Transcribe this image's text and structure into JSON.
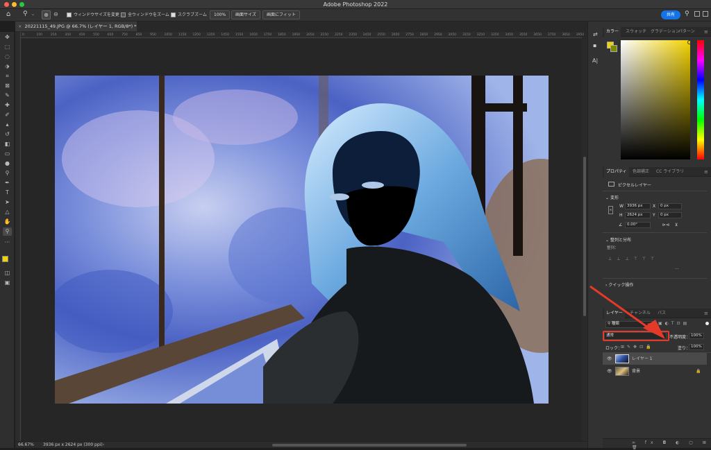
{
  "window": {
    "title": "Adobe Photoshop 2022"
  },
  "options_bar": {
    "resize_windows_label": "ウィンドウサイズを変更",
    "zoom_all_label": "全ウィンドウをズーム",
    "scrubby_zoom_label": "スクラブズーム",
    "zoom_value": "100%",
    "fit_screen_label": "画面サイズ",
    "fill_screen_label": "画面にフィット",
    "share_label": "共有"
  },
  "document": {
    "tab_title": "20221115_49.JPG @ 66.7% (レイヤー 1, RGB/8*) *",
    "ruler_ticks": [
      "0",
      "100",
      "150",
      "200",
      "250",
      "300",
      "350",
      "400",
      "450",
      "500",
      "550",
      "600",
      "650",
      "700",
      "750",
      "800",
      "850",
      "900",
      "950",
      "1000",
      "1050",
      "1100",
      "1150",
      "1200",
      "1250",
      "1300",
      "1350",
      "1400",
      "1450",
      "1500",
      "1550",
      "1600",
      "1650",
      "1700",
      "1750",
      "1800",
      "1850",
      "1900",
      "1950",
      "2000",
      "2050",
      "2100",
      "2150",
      "2200",
      "2250",
      "2300",
      "2350",
      "2400",
      "2450",
      "2500",
      "2550",
      "2600",
      "2650",
      "2700",
      "2750",
      "2800",
      "2850",
      "2900",
      "2950",
      "3000",
      "3050",
      "3100",
      "3150",
      "3200",
      "3250",
      "3300",
      "3350",
      "3400",
      "3450",
      "3500",
      "3550",
      "3600",
      "3650",
      "3700",
      "3750",
      "3800",
      "3850",
      "3900",
      "3950"
    ]
  },
  "status": {
    "zoom": "66.67%",
    "doc_info": "3936 px x 2624 px (300 ppi)"
  },
  "color_panel": {
    "tabs": [
      "カラー",
      "スウォッチ",
      "グラデーション",
      "パターン"
    ],
    "fg_color": "#f2d200",
    "bg_color": "#7a8a00"
  },
  "properties_panel": {
    "tabs": [
      "プロパティ",
      "色調補正",
      "CC ライブラリ"
    ],
    "layer_type": "ピクセルレイヤー",
    "transform_heading": "変形",
    "w_label": "W",
    "w_value": "3936 px",
    "h_label": "H",
    "h_value": "2624 px",
    "x_label": "X",
    "x_value": "0 px",
    "y_label": "Y",
    "y_value": "0 px",
    "angle_value": "0.00°",
    "align_heading": "整列と分布",
    "align_sub": "整列：",
    "quick_actions_heading": "クイック操作"
  },
  "layers_panel": {
    "tabs": [
      "レイヤー",
      "チャンネル",
      "パス"
    ],
    "filter_label": "種類",
    "blend_mode": "通常",
    "opacity_label": "不透明度：",
    "opacity_value": "100%",
    "lock_label": "ロック：",
    "fill_label": "塗り：",
    "fill_value": "100%",
    "layers": [
      {
        "name": "レイヤー 1",
        "selected": true
      },
      {
        "name": "背景",
        "selected": false
      }
    ]
  },
  "annotation": {
    "highlight_color": "#e53a2a"
  }
}
